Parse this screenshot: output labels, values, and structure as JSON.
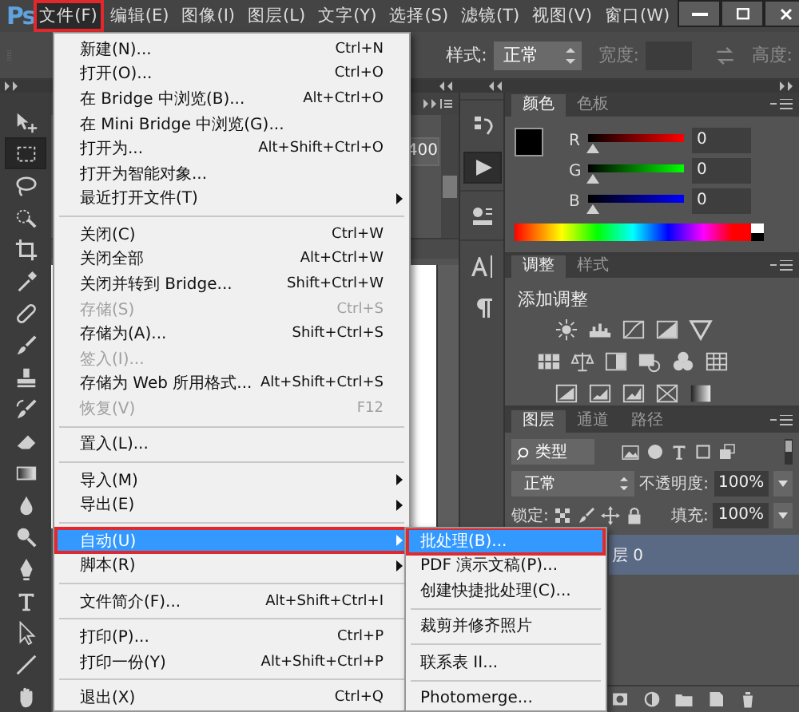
{
  "app": {
    "logo": "Ps"
  },
  "menubar": [
    {
      "label": "文件(F)",
      "selected": true
    },
    {
      "label": "编辑(E)",
      "selected": false
    },
    {
      "label": "图像(I)",
      "selected": false
    },
    {
      "label": "图层(L)",
      "selected": false
    },
    {
      "label": "文字(Y)",
      "selected": false
    },
    {
      "label": "选择(S)",
      "selected": false
    },
    {
      "label": "滤镜(T)",
      "selected": false
    },
    {
      "label": "视图(V)",
      "selected": false
    },
    {
      "label": "窗口(W)",
      "selected": false
    }
  ],
  "options_bar": {
    "style_label": "样式:",
    "style_value": "正常",
    "width": {
      "label": "宽度:",
      "disabled": true
    },
    "height": {
      "label": "高度:",
      "disabled": true
    }
  },
  "toolbar": {
    "tools": [
      {
        "selected": false
      },
      {
        "selected": true
      },
      {
        "selected": false
      },
      {
        "selected": false
      },
      {
        "selected": false
      },
      {
        "selected": false
      },
      {
        "selected": false
      },
      {
        "selected": false
      },
      {
        "selected": false
      },
      {
        "selected": false
      },
      {
        "selected": false
      },
      {
        "selected": false
      },
      {
        "selected": false
      },
      {
        "selected": false
      },
      {
        "selected": false
      },
      {
        "selected": false
      },
      {
        "selected": false
      },
      {
        "selected": false
      },
      {
        "selected": false
      }
    ]
  },
  "side_panel": {
    "value": "400"
  },
  "icon_strip": [
    {
      "selected": false
    },
    {
      "selected": true
    },
    {
      "selected": false
    },
    {
      "selected": false
    },
    {
      "selected": false
    }
  ],
  "color_panel": {
    "tabs": [
      {
        "label": "颜色",
        "selected": true
      },
      {
        "label": "色板",
        "selected": false
      }
    ],
    "channels": [
      {
        "label": "R",
        "value": "0",
        "level": 0
      },
      {
        "label": "G",
        "value": "0",
        "level": 0
      },
      {
        "label": "B",
        "value": "0",
        "level": 0
      }
    ]
  },
  "adjustments_panel": {
    "tabs": [
      {
        "label": "调整",
        "selected": true
      },
      {
        "label": "样式",
        "selected": false
      }
    ],
    "heading": "添加调整"
  },
  "layers_panel": {
    "tabs": [
      {
        "label": "图层",
        "selected": true
      },
      {
        "label": "通道",
        "selected": false
      },
      {
        "label": "路径",
        "selected": false
      }
    ],
    "filter": "类型",
    "blend_mode": "正常",
    "opacity_label": "不透明度:",
    "opacity": "100%",
    "lock_label": "锁定:",
    "fill_label": "填充:",
    "fill": "100%",
    "layers": [
      {
        "name": "层 0",
        "selected": true
      }
    ]
  },
  "file_menu": [
    {
      "kind": "item",
      "label": "新建(N)...",
      "shortcut": "Ctrl+N",
      "disabled": false,
      "submenu": false,
      "selected": false
    },
    {
      "kind": "item",
      "label": "打开(O)...",
      "shortcut": "Ctrl+O",
      "disabled": false,
      "submenu": false,
      "selected": false
    },
    {
      "kind": "item",
      "label": "在 Bridge 中浏览(B)...",
      "shortcut": "Alt+Ctrl+O",
      "disabled": false,
      "submenu": false,
      "selected": false
    },
    {
      "kind": "item",
      "label": "在 Mini Bridge 中浏览(G)...",
      "disabled": false,
      "submenu": false,
      "selected": false
    },
    {
      "kind": "item",
      "label": "打开为...",
      "shortcut": "Alt+Shift+Ctrl+O",
      "disabled": false,
      "submenu": false,
      "selected": false
    },
    {
      "kind": "item",
      "label": "打开为智能对象...",
      "disabled": false,
      "submenu": false,
      "selected": false
    },
    {
      "kind": "item",
      "label": "最近打开文件(T)",
      "disabled": false,
      "submenu": true,
      "selected": false
    },
    {
      "kind": "separator"
    },
    {
      "kind": "item",
      "label": "关闭(C)",
      "shortcut": "Ctrl+W",
      "disabled": false,
      "submenu": false,
      "selected": false
    },
    {
      "kind": "item",
      "label": "关闭全部",
      "shortcut": "Alt+Ctrl+W",
      "disabled": false,
      "submenu": false,
      "selected": false
    },
    {
      "kind": "item",
      "label": "关闭并转到 Bridge...",
      "shortcut": "Shift+Ctrl+W",
      "disabled": false,
      "submenu": false,
      "selected": false
    },
    {
      "kind": "item",
      "label": "存储(S)",
      "shortcut": "Ctrl+S",
      "disabled": true,
      "submenu": false,
      "selected": false
    },
    {
      "kind": "item",
      "label": "存储为(A)...",
      "shortcut": "Shift+Ctrl+S",
      "disabled": false,
      "submenu": false,
      "selected": false
    },
    {
      "kind": "item",
      "label": "签入(I)...",
      "disabled": true,
      "submenu": false,
      "selected": false
    },
    {
      "kind": "item",
      "label": "存储为 Web 所用格式...",
      "shortcut": "Alt+Shift+Ctrl+S",
      "disabled": false,
      "submenu": false,
      "selected": false
    },
    {
      "kind": "item",
      "label": "恢复(V)",
      "shortcut": "F12",
      "disabled": true,
      "submenu": false,
      "selected": false
    },
    {
      "kind": "separator"
    },
    {
      "kind": "item",
      "label": "置入(L)...",
      "disabled": false,
      "submenu": false,
      "selected": false
    },
    {
      "kind": "separator"
    },
    {
      "kind": "item",
      "label": "导入(M)",
      "disabled": false,
      "submenu": true,
      "selected": false
    },
    {
      "kind": "item",
      "label": "导出(E)",
      "disabled": false,
      "submenu": true,
      "selected": false
    },
    {
      "kind": "separator"
    },
    {
      "kind": "item",
      "label": "自动(U)",
      "disabled": false,
      "submenu": true,
      "selected": true
    },
    {
      "kind": "item",
      "label": "脚本(R)",
      "disabled": false,
      "submenu": true,
      "selected": false
    },
    {
      "kind": "separator"
    },
    {
      "kind": "item",
      "label": "文件简介(F)...",
      "shortcut": "Alt+Shift+Ctrl+I",
      "disabled": false,
      "submenu": false,
      "selected": false
    },
    {
      "kind": "separator"
    },
    {
      "kind": "item",
      "label": "打印(P)...",
      "shortcut": "Ctrl+P",
      "disabled": false,
      "submenu": false,
      "selected": false
    },
    {
      "kind": "item",
      "label": "打印一份(Y)",
      "shortcut": "Alt+Shift+Ctrl+P",
      "disabled": false,
      "submenu": false,
      "selected": false
    },
    {
      "kind": "separator"
    },
    {
      "kind": "item",
      "label": "退出(X)",
      "shortcut": "Ctrl+Q",
      "disabled": false,
      "submenu": false,
      "selected": false
    }
  ],
  "automate_submenu": [
    {
      "kind": "item",
      "label": "批处理(B)...",
      "disabled": false,
      "submenu": false,
      "selected": true
    },
    {
      "kind": "item",
      "label": "PDF 演示文稿(P)...",
      "disabled": false,
      "submenu": false,
      "selected": false
    },
    {
      "kind": "item",
      "label": "创建快捷批处理(C)...",
      "disabled": false,
      "submenu": false,
      "selected": false
    },
    {
      "kind": "separator"
    },
    {
      "kind": "item",
      "label": "裁剪并修齐照片",
      "disabled": false,
      "submenu": false,
      "selected": false
    },
    {
      "kind": "separator"
    },
    {
      "kind": "item",
      "label": "联系表 II...",
      "disabled": false,
      "submenu": false,
      "selected": false
    },
    {
      "kind": "separator"
    },
    {
      "kind": "item",
      "label": "Photomerge...",
      "disabled": false,
      "submenu": false,
      "selected": false
    }
  ]
}
